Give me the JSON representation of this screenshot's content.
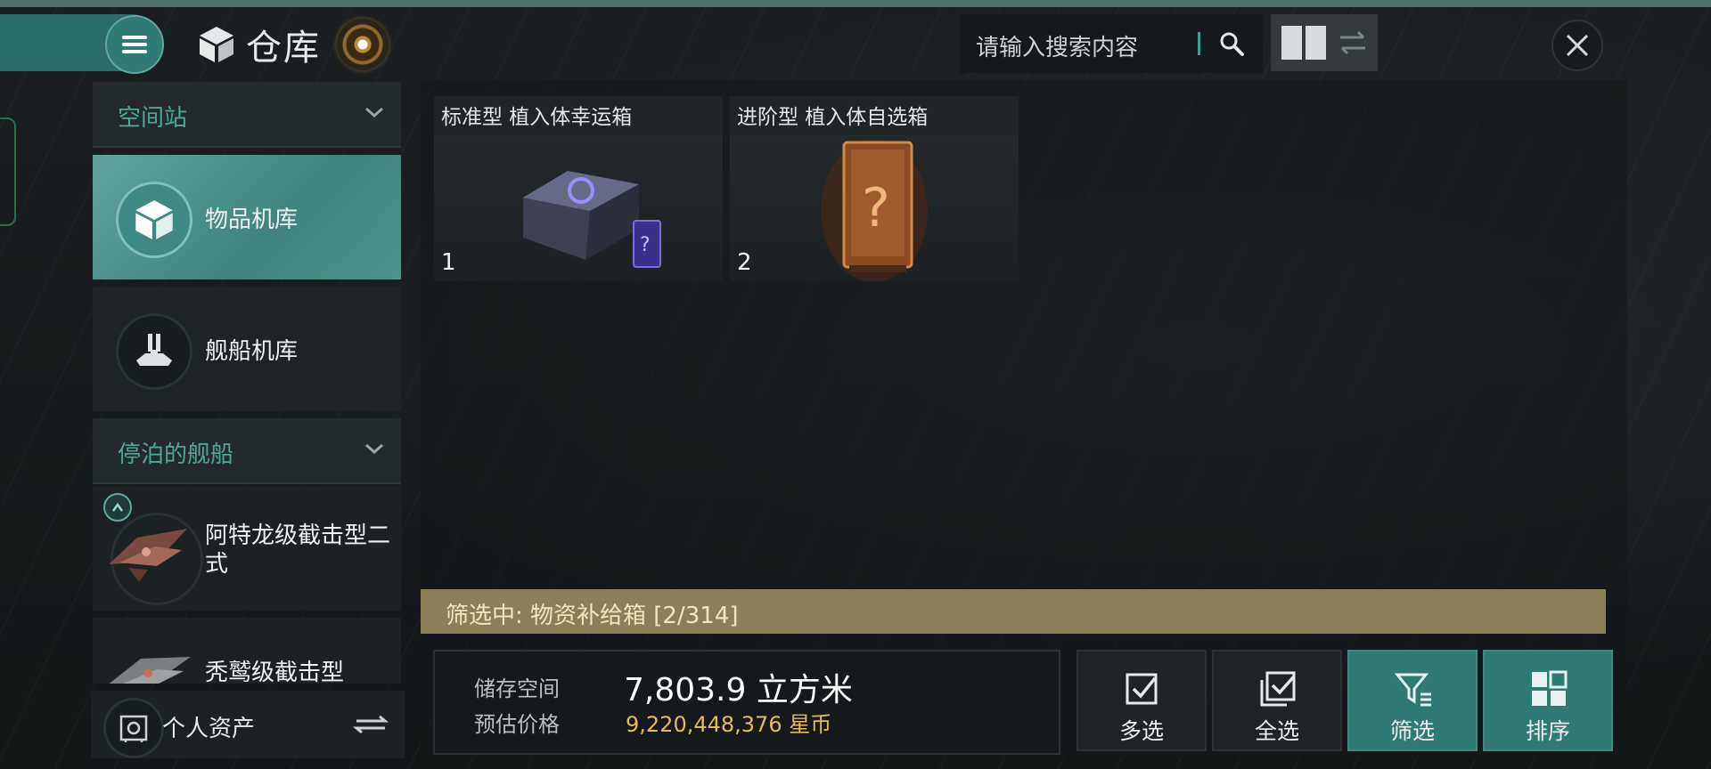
{
  "header": {
    "title": "仓库",
    "search_placeholder": "请输入搜索内容"
  },
  "sidebar": {
    "sections": [
      {
        "label": "空间站"
      },
      {
        "label": "停泊的舰船"
      }
    ],
    "nav_items": [
      {
        "label": "物品机库",
        "active": true
      },
      {
        "label": "舰船机库",
        "active": false
      }
    ],
    "ships": [
      {
        "name": "阿特龙级截击型二式"
      },
      {
        "name": "秃鹫级截击型"
      }
    ],
    "assets_label": "个人资产"
  },
  "items": [
    {
      "name": "标准型 植入体幸运箱",
      "qty": "1"
    },
    {
      "name": "进阶型 植入体自选箱",
      "qty": "2"
    }
  ],
  "filter_status": "筛选中: 物资补给箱 [2/314]",
  "storage": {
    "space_label": "储存空间",
    "space_value": "7,803.9 立方米",
    "price_label": "预估价格",
    "price_value": "9,220,448,376 星币"
  },
  "actions": [
    {
      "label": "多选",
      "icon": "checkbox-icon"
    },
    {
      "label": "全选",
      "icon": "select-all-icon"
    },
    {
      "label": "筛选",
      "icon": "filter-icon"
    },
    {
      "label": "排序",
      "icon": "grid-icon"
    }
  ],
  "colors": {
    "accent": "#3f857d",
    "filter_bar": "#8a7f58",
    "price": "#e3bd5a"
  }
}
